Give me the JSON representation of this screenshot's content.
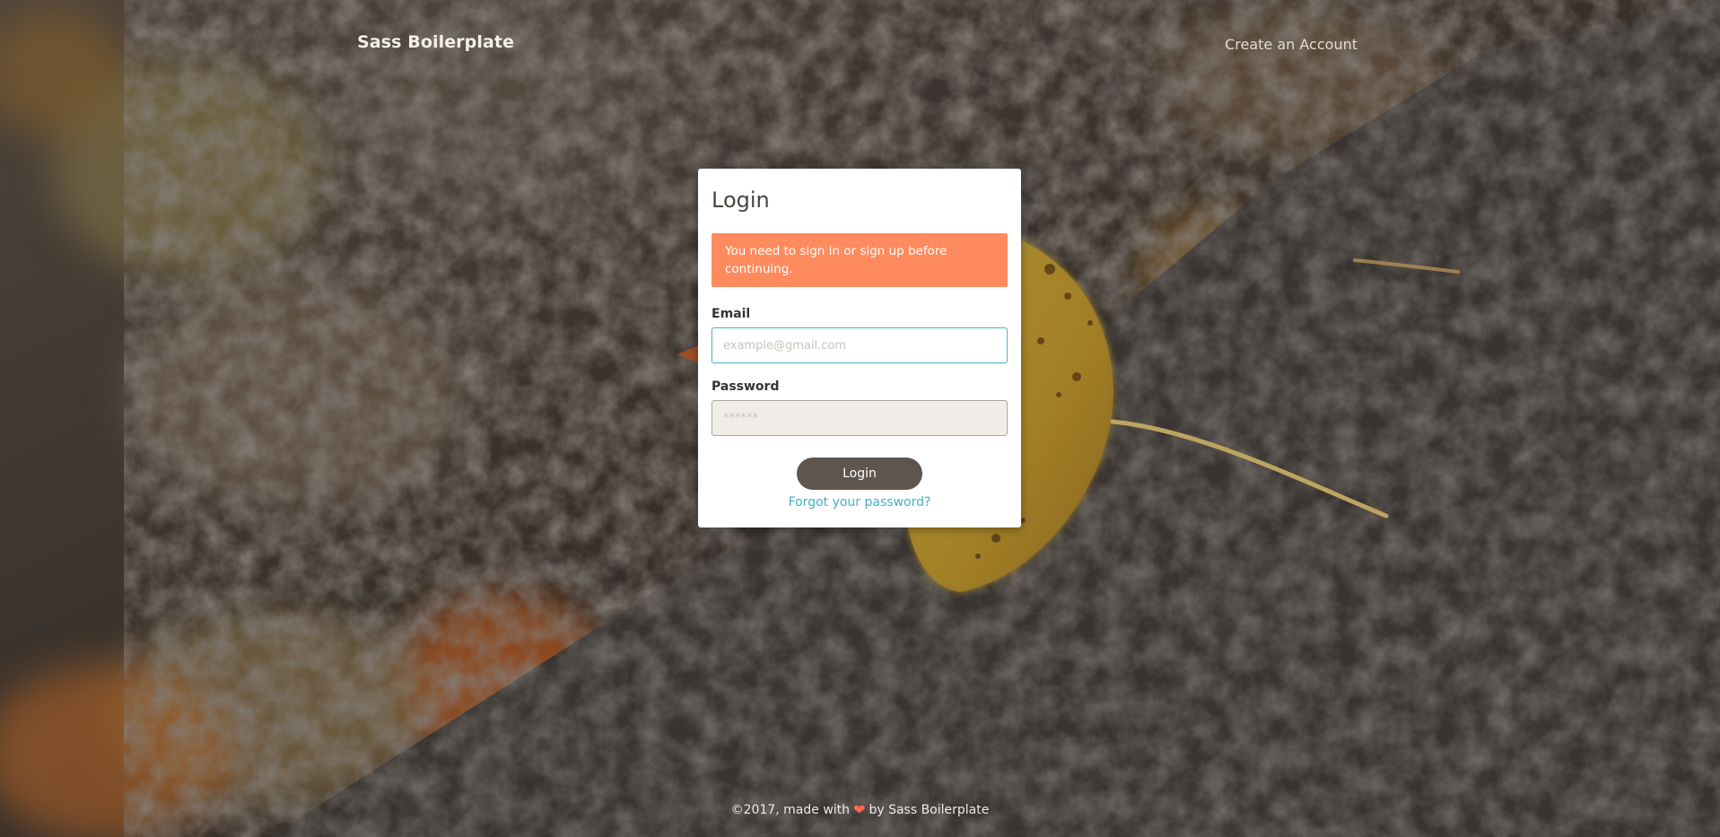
{
  "header": {
    "brand": "Sass Boilerplate",
    "create_account": "Create an Account"
  },
  "login": {
    "title": "Login",
    "alert": "You need to sign in or sign up before continuing.",
    "email_label": "Email",
    "email_placeholder": "example@gmail.com",
    "email_value": "",
    "password_label": "Password",
    "password_placeholder": "******",
    "password_value": "",
    "submit_label": "Login",
    "forgot_label": "Forgot your password?"
  },
  "footer": {
    "prefix": "©2017, made with",
    "icon": "heart-icon",
    "suffix": "by Sass Boilerplate"
  },
  "colors": {
    "alert_bg": "#ff8a5e",
    "button_bg": "#5d554e",
    "link": "#42b0c8",
    "focus_border": "#4fb8cc"
  }
}
